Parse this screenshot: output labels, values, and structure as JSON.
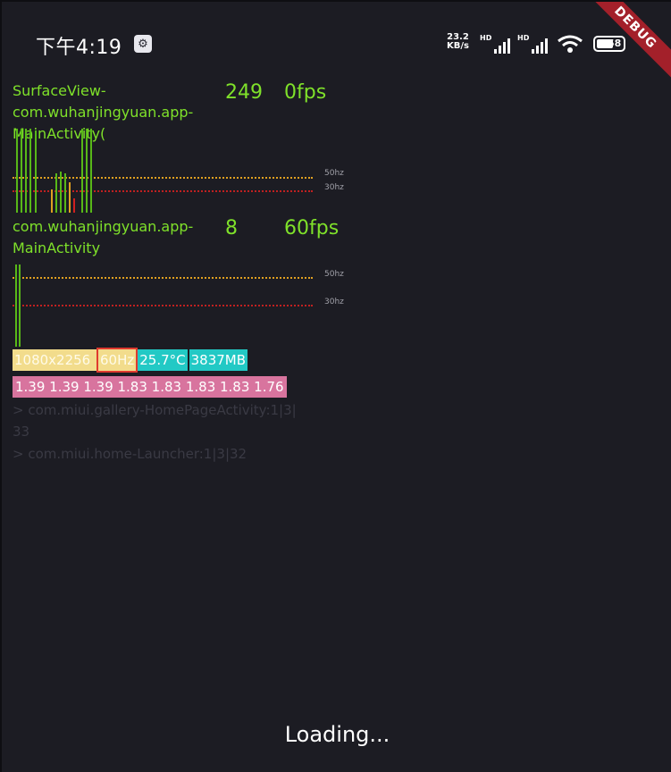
{
  "status": {
    "time": "下午4:19",
    "net_speed_value": "23.2",
    "net_speed_unit": "KB/s",
    "hd_label_1": "HD",
    "hd_label_2": "HD",
    "battery": "58",
    "debug_banner": "DEBUG"
  },
  "overlay": {
    "surface": {
      "name": "SurfaceView-com.wuhanjingyuan.app-MainActivity(",
      "count": "249",
      "fps": "0fps",
      "line_50": "50hz",
      "line_30": "30hz"
    },
    "activity": {
      "name": "com.wuhanjingyuan.app-MainActivity",
      "count": "8",
      "fps": "60fps",
      "line_50": "50hz",
      "line_30": "30hz"
    },
    "chips": {
      "resolution": "1080x2256",
      "refresh": "60Hz",
      "temperature": "25.7°C",
      "memory": "3837MB"
    },
    "load": "1.39 1.39 1.39 1.83 1.83 1.83 1.83 1.76",
    "processes": [
      "> com.miui.gallery-HomePageActivity:1|3|",
      "33",
      "> com.miui.home-Launcher:1|3|32"
    ]
  },
  "loading_text": "Loading...",
  "colors": {
    "background": "#1c1c23",
    "overlay_green": "#7fe12a",
    "chip_yellow": "#f2dc8c",
    "chip_cyan": "#22c9c5",
    "load_pink": "#d8749e",
    "debug_red": "#a3202a"
  }
}
